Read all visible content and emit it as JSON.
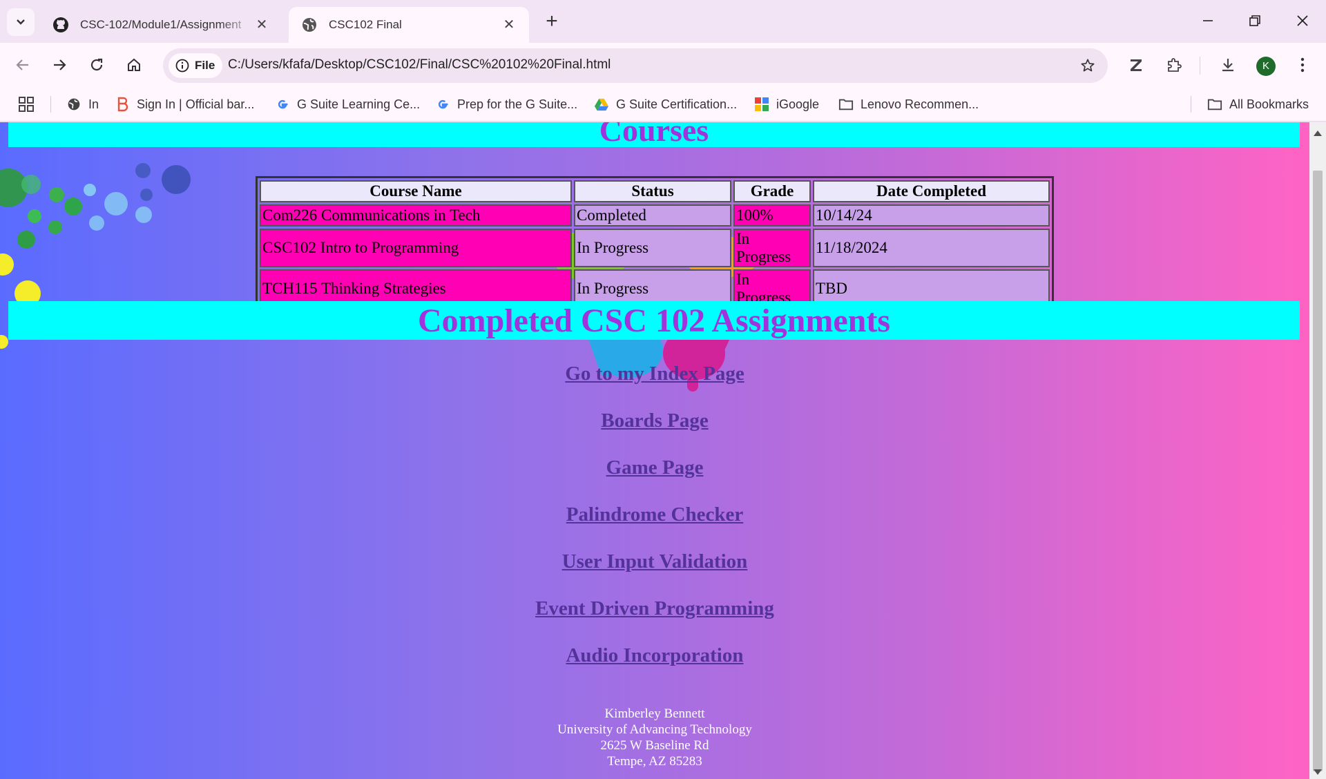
{
  "browser": {
    "tabs": [
      {
        "title": "CSC-102/Module1/Assignment",
        "icon": "github-icon",
        "active": false
      },
      {
        "title": "CSC102 Final",
        "icon": "globe-icon",
        "active": true
      }
    ],
    "address": {
      "chip_label": "File",
      "url": "C:/Users/kfafa/Desktop/CSC102/Final/CSC%20102%20Final.html"
    },
    "profile_initial": "K",
    "bookmarks": [
      {
        "label": "In",
        "icon": "globe-icon"
      },
      {
        "label": "Sign In | Official bar...",
        "icon": "barbri-icon"
      },
      {
        "label": "G Suite Learning Ce...",
        "icon": "google-icon"
      },
      {
        "label": "Prep for the G Suite...",
        "icon": "google-icon"
      },
      {
        "label": "G Suite Certification...",
        "icon": "drive-icon"
      },
      {
        "label": "iGoogle",
        "icon": "igoogle-icon"
      },
      {
        "label": "Lenovo Recommen...",
        "icon": "folder-icon"
      }
    ],
    "all_bookmarks_label": "All Bookmarks"
  },
  "page": {
    "courses_heading": "Courses",
    "table": {
      "headers": [
        "Course Name",
        "Status",
        "Grade",
        "Date Completed"
      ],
      "rows": [
        [
          "Com226 Communications in Tech",
          "Completed",
          "100%",
          "10/14/24"
        ],
        [
          "CSC102 Intro to Programming",
          "In Progress",
          "In Progress",
          "11/18/2024"
        ],
        [
          "TCH115 Thinking Strategies",
          "In Progress",
          "In Progress",
          "TBD"
        ]
      ]
    },
    "assignments_heading": "Completed CSC 102 Assignments",
    "links": [
      "Go to my Index Page",
      "Boards Page",
      "Game Page",
      "Palindrome Checker",
      "User Input Validation",
      "Event Driven Programming",
      "Audio Incorporation"
    ],
    "footer": {
      "name": "Kimberley Bennett",
      "school": "University of Advancing Technology",
      "street": "2625 W Baseline Rd",
      "city": "Tempe, AZ 85283"
    }
  },
  "colors": {
    "banner_bg": "#00ffff",
    "heading_text": "#a133dc",
    "name_cell": "#ff00b4",
    "status_cell": "#c8a0ea",
    "link": "#53339a"
  }
}
